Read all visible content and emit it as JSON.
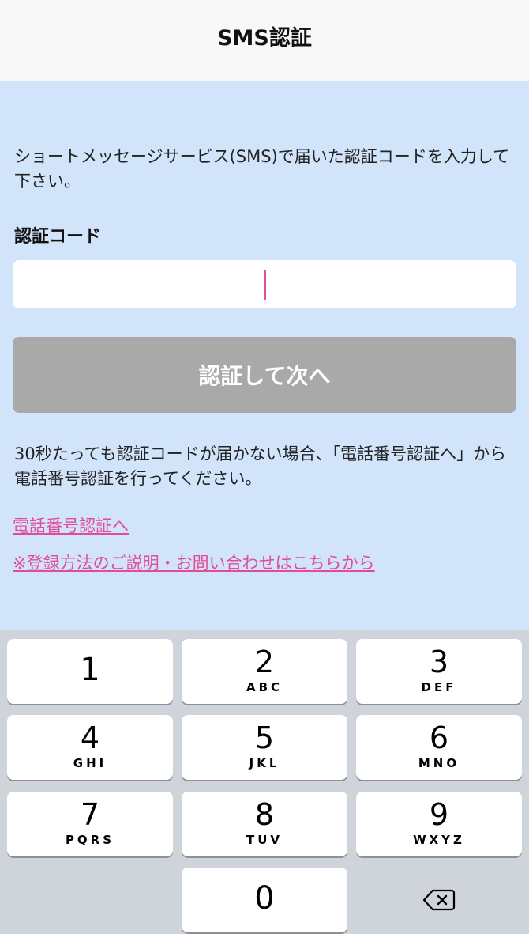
{
  "nav": {
    "title": "SMS認証"
  },
  "main": {
    "description": "ショートメッセージサービス(SMS)で届いた認証コードを入力して下さい。",
    "code_label": "認証コード",
    "code_value": "",
    "next_button": "認証して次へ",
    "note": "30秒たっても認証コードが届かない場合、「電話番号認証へ」から電話番号認証を行ってください。",
    "link_phone": "電話番号認証へ",
    "link_help": "※登録方法のご説明・お問い合わせはこちらから"
  },
  "colors": {
    "background": "#d1e4fa",
    "link": "#e24c95",
    "caret": "#e34f97",
    "disabled_button": "#a9a9a9"
  },
  "keyboard": {
    "keys": [
      {
        "digit": "1",
        "letters": ""
      },
      {
        "digit": "2",
        "letters": "ABC"
      },
      {
        "digit": "3",
        "letters": "DEF"
      },
      {
        "digit": "4",
        "letters": "GHI"
      },
      {
        "digit": "5",
        "letters": "JKL"
      },
      {
        "digit": "6",
        "letters": "MNO"
      },
      {
        "digit": "7",
        "letters": "PQRS"
      },
      {
        "digit": "8",
        "letters": "TUV"
      },
      {
        "digit": "9",
        "letters": "WXYZ"
      },
      {
        "digit": "0",
        "letters": ""
      }
    ],
    "delete_icon": "backspace-icon"
  }
}
